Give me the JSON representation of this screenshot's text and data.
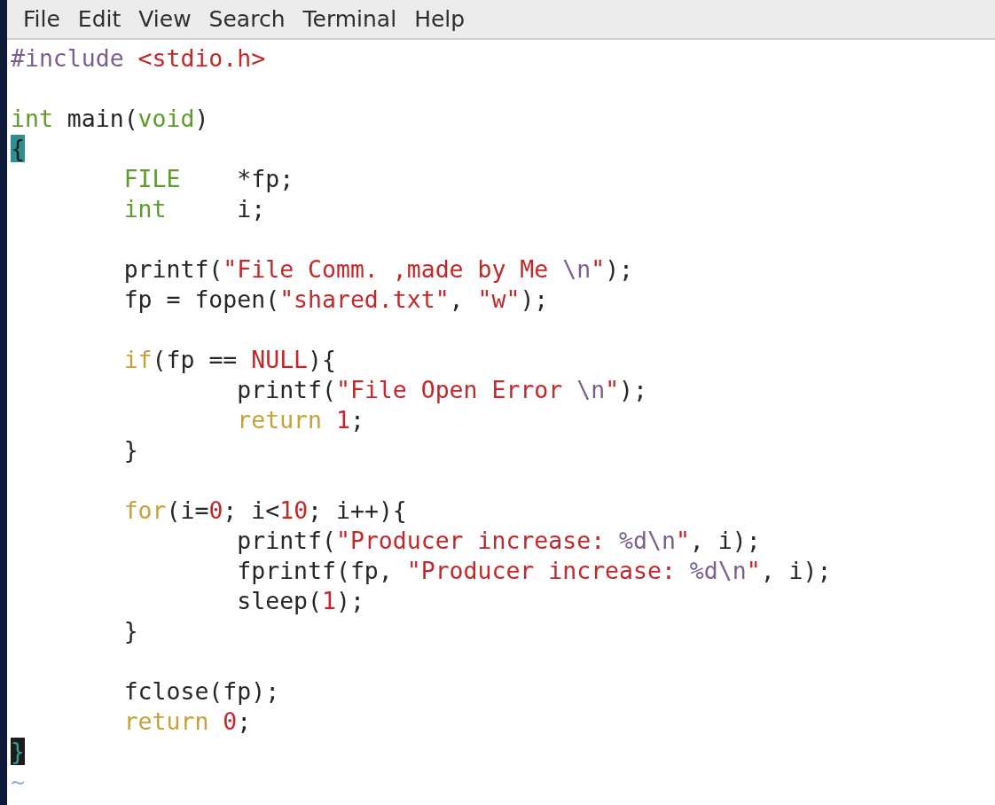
{
  "menu": [
    "File",
    "Edit",
    "View",
    "Search",
    "Terminal",
    "Help"
  ],
  "lines": [
    {
      "kind": "code",
      "segments": [
        {
          "kind": "pre",
          "text": "#include "
        },
        {
          "kind": "str",
          "text": "<stdio.h>"
        }
      ]
    },
    {
      "kind": "blank"
    },
    {
      "kind": "code",
      "segments": [
        {
          "kind": "type",
          "text": "int"
        },
        {
          "kind": "plain",
          "text": " main("
        },
        {
          "kind": "type",
          "text": "void"
        },
        {
          "kind": "plain",
          "text": ")"
        }
      ]
    },
    {
      "kind": "code",
      "segments": [
        {
          "kind": "cursor",
          "text": "{"
        }
      ]
    },
    {
      "kind": "code",
      "segments": [
        {
          "kind": "type",
          "text": "\tFILE"
        },
        {
          "kind": "plain",
          "text": "\t*fp;"
        }
      ]
    },
    {
      "kind": "code",
      "segments": [
        {
          "kind": "type",
          "text": "\tint"
        },
        {
          "kind": "plain",
          "text": "\ti;"
        }
      ]
    },
    {
      "kind": "blank"
    },
    {
      "kind": "code",
      "segments": [
        {
          "kind": "plain",
          "text": "\tprintf("
        },
        {
          "kind": "str",
          "text": "\"File Comm. ,made by Me "
        },
        {
          "kind": "esc",
          "text": "\\n"
        },
        {
          "kind": "str",
          "text": "\""
        },
        {
          "kind": "plain",
          "text": ");"
        }
      ]
    },
    {
      "kind": "code",
      "segments": [
        {
          "kind": "plain",
          "text": "\tfp = fopen("
        },
        {
          "kind": "str",
          "text": "\"shared.txt\""
        },
        {
          "kind": "plain",
          "text": ", "
        },
        {
          "kind": "str",
          "text": "\"w\""
        },
        {
          "kind": "plain",
          "text": ");"
        }
      ]
    },
    {
      "kind": "blank"
    },
    {
      "kind": "code",
      "segments": [
        {
          "kind": "kw",
          "text": "\tif"
        },
        {
          "kind": "plain",
          "text": "(fp == "
        },
        {
          "kind": "str",
          "text": "NULL"
        },
        {
          "kind": "plain",
          "text": "){"
        }
      ]
    },
    {
      "kind": "code",
      "segments": [
        {
          "kind": "plain",
          "text": "\t\tprintf("
        },
        {
          "kind": "str",
          "text": "\"File Open Error "
        },
        {
          "kind": "esc",
          "text": "\\n"
        },
        {
          "kind": "str",
          "text": "\""
        },
        {
          "kind": "plain",
          "text": ");"
        }
      ]
    },
    {
      "kind": "code",
      "segments": [
        {
          "kind": "kw",
          "text": "\t\treturn "
        },
        {
          "kind": "str",
          "text": "1"
        },
        {
          "kind": "plain",
          "text": ";"
        }
      ]
    },
    {
      "kind": "code",
      "segments": [
        {
          "kind": "plain",
          "text": "\t}"
        }
      ]
    },
    {
      "kind": "blank"
    },
    {
      "kind": "code",
      "segments": [
        {
          "kind": "kw",
          "text": "\tfor"
        },
        {
          "kind": "plain",
          "text": "(i="
        },
        {
          "kind": "str",
          "text": "0"
        },
        {
          "kind": "plain",
          "text": "; i<"
        },
        {
          "kind": "str",
          "text": "10"
        },
        {
          "kind": "plain",
          "text": "; i++){"
        }
      ]
    },
    {
      "kind": "code",
      "segments": [
        {
          "kind": "plain",
          "text": "\t\tprintf("
        },
        {
          "kind": "str",
          "text": "\"Producer increase: "
        },
        {
          "kind": "esc",
          "text": "%d\\n"
        },
        {
          "kind": "str",
          "text": "\""
        },
        {
          "kind": "plain",
          "text": ", i);"
        }
      ]
    },
    {
      "kind": "code",
      "segments": [
        {
          "kind": "plain",
          "text": "\t\tfprintf(fp, "
        },
        {
          "kind": "str",
          "text": "\"Producer increase: "
        },
        {
          "kind": "esc",
          "text": "%d\\n"
        },
        {
          "kind": "str",
          "text": "\""
        },
        {
          "kind": "plain",
          "text": ", i);"
        }
      ]
    },
    {
      "kind": "code",
      "segments": [
        {
          "kind": "plain",
          "text": "\t\tsleep("
        },
        {
          "kind": "str",
          "text": "1"
        },
        {
          "kind": "plain",
          "text": ");"
        }
      ]
    },
    {
      "kind": "code",
      "segments": [
        {
          "kind": "plain",
          "text": "\t}"
        }
      ]
    },
    {
      "kind": "blank"
    },
    {
      "kind": "code",
      "segments": [
        {
          "kind": "plain",
          "text": "\tfclose(fp);"
        }
      ]
    },
    {
      "kind": "code",
      "segments": [
        {
          "kind": "kw",
          "text": "\treturn "
        },
        {
          "kind": "str",
          "text": "0"
        },
        {
          "kind": "plain",
          "text": ";"
        }
      ]
    },
    {
      "kind": "code",
      "segments": [
        {
          "kind": "match",
          "text": "}"
        }
      ]
    },
    {
      "kind": "tilde",
      "text": "~"
    }
  ]
}
